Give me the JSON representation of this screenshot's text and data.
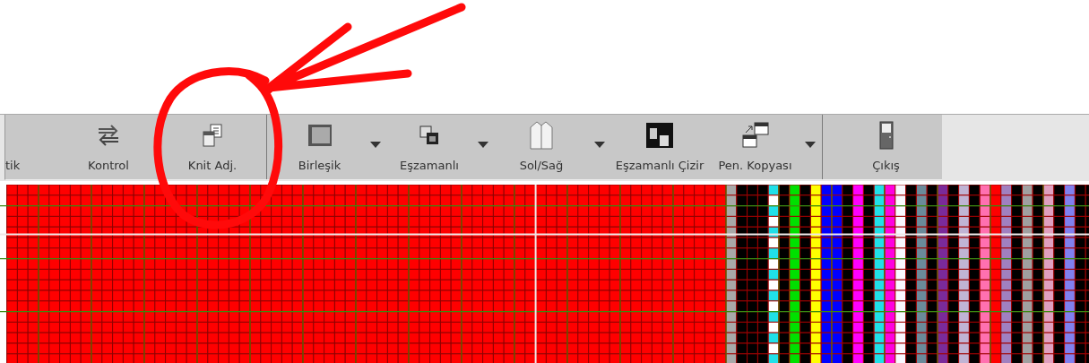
{
  "toolbar": {
    "items": [
      {
        "label": "tik",
        "dropdown": false,
        "separator_after": false
      },
      {
        "label": "Kontrol",
        "dropdown": false,
        "separator_after": false
      },
      {
        "label": "Knit Adj.",
        "dropdown": false,
        "separator_after": true
      },
      {
        "label": "Birleşik",
        "dropdown": true,
        "separator_after": false
      },
      {
        "label": "Eşzamanlı",
        "dropdown": true,
        "separator_after": false
      },
      {
        "label": "Sol/Sağ",
        "dropdown": true,
        "separator_after": false
      },
      {
        "label": "Eşzamanlı Çizir",
        "dropdown": false,
        "separator_after": false
      },
      {
        "label": "Pen. Kopyası",
        "dropdown": true,
        "separator_after": true
      },
      {
        "label": "Çıkış",
        "dropdown": false,
        "separator_after": false
      }
    ]
  }
}
